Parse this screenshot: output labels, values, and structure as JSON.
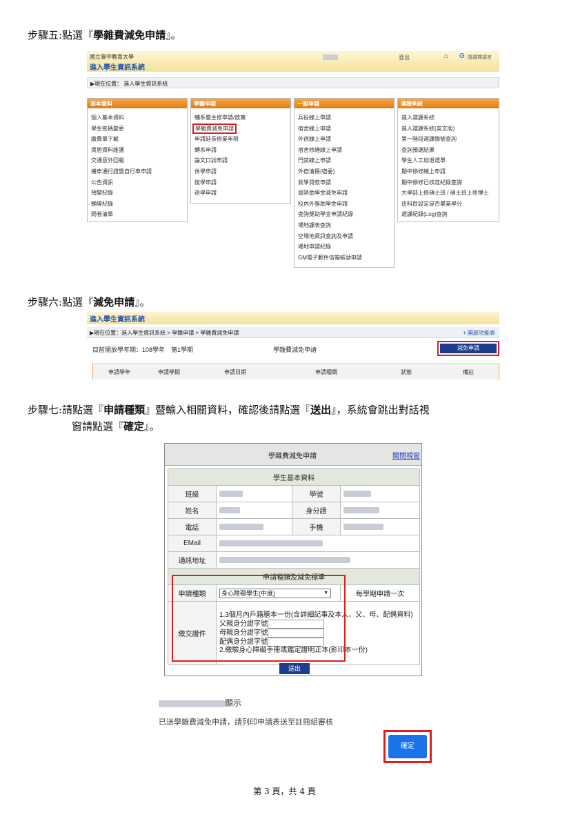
{
  "steps": {
    "s5_pre": "步驟五:點選『",
    "s5_bold": "學雜費減免申請",
    "s5_post": "』。",
    "s6_pre": "步驟六:點選『",
    "s6_bold": "減免申請",
    "s6_post": "』。",
    "s7_pre": "步驟七:請點選『",
    "s7_bold1": "申請種類",
    "s7_mid": "』暨輸入相關資料，確認後請點選『",
    "s7_bold2": "送出",
    "s7_mid2": "』，系統會跳出對話視",
    "s7_line2_pre": "窗請點選『",
    "s7_bold3": "確定",
    "s7_line2_post": "』。"
  },
  "shot1": {
    "university": "國立臺中教育大學",
    "system": "進入學生資訊系統",
    "logout": "登出",
    "lang": "請選擇語言",
    "breadcrumb": "現在位置： 進入學生資訊系統",
    "boxes": [
      {
        "title": "基本資料",
        "items": [
          "個人基本資料",
          "學生密碼變更",
          "繳費單下載",
          "賃居資料維護",
          "交通意外回報",
          "機車通行證暨自行車申請",
          "公告資訊",
          "預警紀錄",
          "輔導紀錄",
          "問卷清單"
        ]
      },
      {
        "title": "學籍申請",
        "items": [
          "輔系雙主修申請/放棄",
          "學雜費減免申請",
          "申請延長修業年限",
          "轉系申請",
          "論文口試申請",
          "休學申請",
          "復學申請",
          "退學申請"
        ]
      },
      {
        "title": "一般申請",
        "items": [
          "兵役線上申請",
          "宿舍線上申請",
          "外宿線上申請",
          "宿舍修繕線上申請",
          "門禁線上申請",
          "外宿清冊(宿委)",
          "就學貸款申請",
          "弱勢助學金減免申請",
          "校內外獎助學金申請",
          "查詢獎助學金申請紀錄",
          "場地課表查詢",
          "空場地資訊查詢及申請",
          "場地申請紀錄",
          "GM電子郵件信箱帳號申請"
        ]
      },
      {
        "title": "選課系統",
        "items": [
          "進入選課系統",
          "進入選課系統(英文版)",
          "第一階段選課篩號查詢",
          "查詢預選結果",
          "學生人工加退選單",
          "期中停修線上申請",
          "期中停修已核准紀錄查詢",
          "大學部上修碩士班 / 碩士班上修博士",
          "班科目設定是否畢業學分",
          "選課紀錄(Log)查詢"
        ]
      }
    ]
  },
  "shot2": {
    "system": "進入學生資訊系統",
    "breadcrumb": "現在位置：進入學生資訊系統 > 學籍申請 > 學雜費減免申請",
    "menu": "+ 開啟功能表",
    "semester": "目前開放學年期：108學年　第1學期",
    "title": "學雜費減免申請",
    "button": "減免申請",
    "headers": [
      "申請學年",
      "申請學期",
      "申請日期",
      "申請種類",
      "狀態",
      "備註"
    ]
  },
  "shot3": {
    "title": "學雜費減免申請",
    "close": "關閉視窗",
    "basic": "學生基本資料",
    "class_label": "班級",
    "student_no_label": "學號",
    "name_label": "姓名",
    "id_label": "身分證",
    "phone_label": "電話",
    "mobile_label": "手機",
    "email_label": "EMail",
    "address_label": "通訊地址",
    "category_section": "申請種類及減免標準",
    "type_label": "申請種類",
    "type_value": "身心障礙學生(中度)",
    "type_note": "每學期申請一次",
    "docs_label": "繳交證件",
    "doc1": "1.3個月內戶籍謄本一份(含詳細記事及本人、父、母、配偶資料)",
    "father": "父親身分證字號",
    "mother": "母親身分證字號",
    "spouse": "配偶身分證字號",
    "doc2": "2.繳驗身心障礙手冊或鑑定證明正本(影印本一份)",
    "submit": "送出"
  },
  "result": {
    "suffix": "顯示",
    "message": "已送學雜費減免申請，請列印申請表送至註冊組審核",
    "ok": "確定"
  },
  "footer": "第 3 頁，共 4 頁"
}
